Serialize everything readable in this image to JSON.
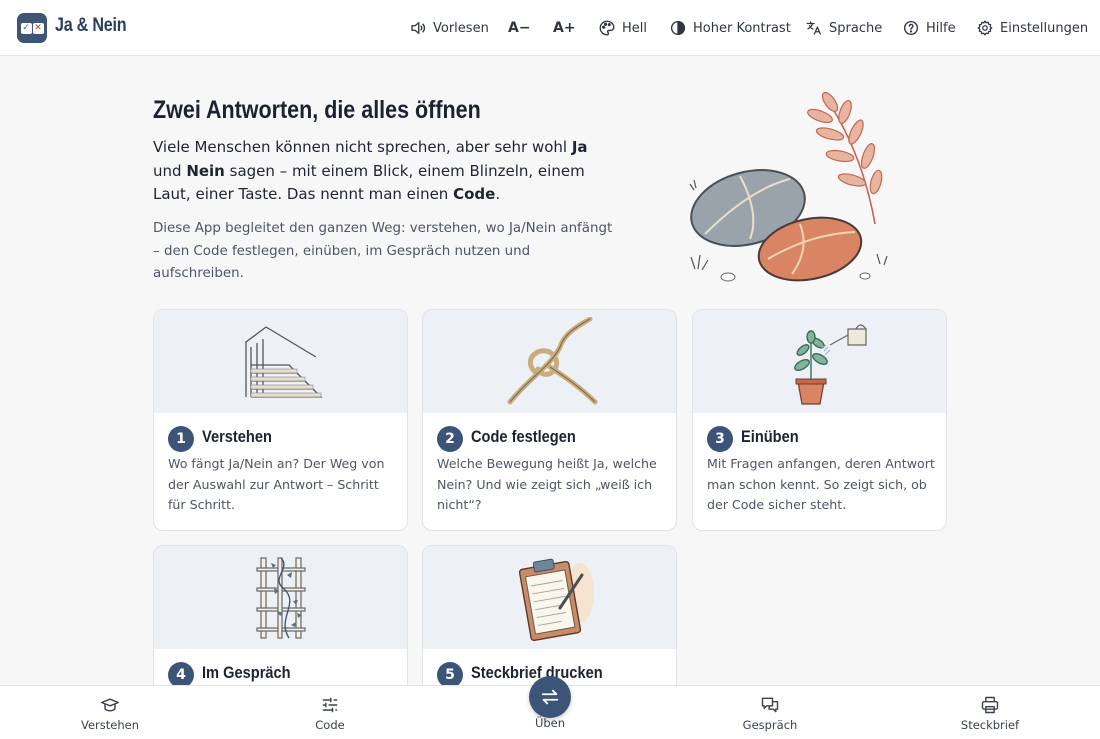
{
  "app": {
    "title": "Ja & Nein"
  },
  "header": {
    "buttons": [
      {
        "label": "Vorlesen",
        "icon": "speaker-icon"
      },
      {
        "label": "A−",
        "icon": "font-decrease-icon"
      },
      {
        "label": "A+",
        "icon": "font-increase-icon"
      },
      {
        "label": "Hell",
        "icon": "palette-icon"
      },
      {
        "label": "Hoher Kontrast",
        "icon": "contrast-icon"
      },
      {
        "label": "Sprache",
        "icon": "translate-icon"
      },
      {
        "label": "Hilfe",
        "icon": "help-icon"
      },
      {
        "label": "Einstellungen",
        "icon": "gear-icon"
      }
    ]
  },
  "hero": {
    "title": "Zwei Antworten, die alles öffnen",
    "p1": {
      "a": "Viele Menschen können nicht sprechen, aber sehr wohl ",
      "ja": "Ja",
      "b": " und ",
      "nein": "Nein",
      "c": " sagen – mit einem Blick, einem Blinzeln, einem Laut, einer Taste. Das nennt man einen ",
      "code": "Code",
      "d": "."
    },
    "p2": "Diese App begleitet den ganzen Weg: verstehen, wo Ja/Nein anfängt – den Code festlegen, einüben, im Gespräch nutzen und aufschreiben."
  },
  "cards": [
    {
      "num": "1",
      "title": "Verstehen",
      "desc": "Wo fängt Ja/Nein an? Der Weg von der Auswahl zur Antwort – Schritt für Schritt.",
      "icon": "stairs-icon"
    },
    {
      "num": "2",
      "title": "Code festlegen",
      "desc": "Welche Bewegung heißt Ja, welche Nein? Und wie zeigt sich „weiß ich nicht“?",
      "icon": "knot-icon"
    },
    {
      "num": "3",
      "title": "Einüben",
      "desc": "Mit Fragen anfangen, deren Antwort man schon kennt. So zeigt sich, ob der Code sicher steht.",
      "icon": "watering-plant-icon"
    },
    {
      "num": "4",
      "title": "Im Gespräch",
      "desc": "",
      "icon": "trellis-ivy-icon"
    },
    {
      "num": "5",
      "title": "Steckbrief drucken",
      "desc": "",
      "icon": "clipboard-icon"
    }
  ],
  "bottom_nav": {
    "items": [
      {
        "label": "Verstehen",
        "icon": "graduation-cap-icon"
      },
      {
        "label": "Code",
        "icon": "sliders-icon"
      },
      {
        "label": "Üben",
        "icon": "swap-arrows-icon"
      },
      {
        "label": "Gespräch",
        "icon": "chat-icon"
      },
      {
        "label": "Steckbrief",
        "icon": "printer-icon"
      }
    ]
  },
  "colors": {
    "accent": "#3c5478",
    "background": "#f7f7f7",
    "card_pic": "#edf0f5"
  }
}
